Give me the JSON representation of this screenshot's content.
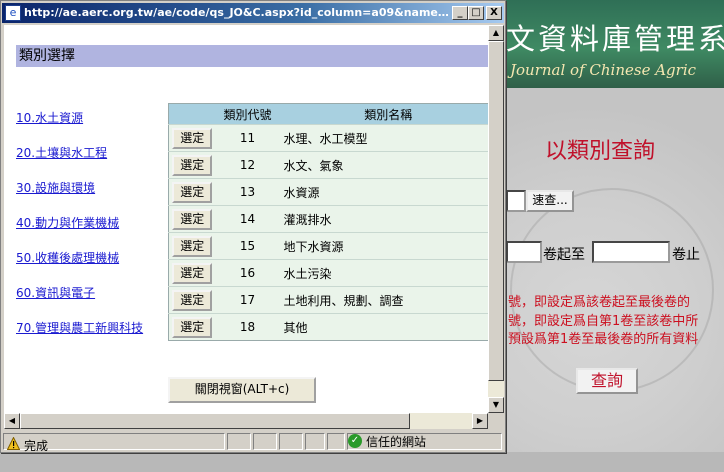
{
  "popup": {
    "title": "http://ae.aerc.org.tw/ae/code/qs_JO&C.aspx?id_column=a09&name_colum...",
    "section_title": "類別選擇",
    "categories": [
      {
        "label": "10.水土資源"
      },
      {
        "label": "20.土壤與水工程"
      },
      {
        "label": "30.設施與環境"
      },
      {
        "label": "40.動力與作業機械"
      },
      {
        "label": "50.收穫後處理機械"
      },
      {
        "label": "60.資訊與電子"
      },
      {
        "label": "70.管理與農工新興科技"
      }
    ],
    "table": {
      "headers": [
        "",
        "類別代號",
        "類別名稱"
      ],
      "select_label": "選定",
      "rows": [
        {
          "code": "11",
          "name": "水理、水工模型"
        },
        {
          "code": "12",
          "name": "水文、氣象"
        },
        {
          "code": "13",
          "name": "水資源"
        },
        {
          "code": "14",
          "name": "灌溉排水"
        },
        {
          "code": "15",
          "name": "地下水資源"
        },
        {
          "code": "16",
          "name": "水土污染"
        },
        {
          "code": "17",
          "name": "土地利用、規劃、調查"
        },
        {
          "code": "18",
          "name": "其他"
        }
      ]
    },
    "close_button": "關閉視窗(ALT+c)",
    "status": {
      "done": "完成",
      "zone": "信任的網站"
    },
    "window_buttons": {
      "minimize": "_",
      "maximize": "□",
      "close": "X"
    }
  },
  "background": {
    "title_cn": "文資料庫管理系",
    "title_en": "Journal of Chinese Agric",
    "heading": "以類別查詢",
    "quick_button": "速查...",
    "range_from": "卷起至",
    "range_to": "卷止",
    "notes": [
      "號，即設定爲該卷起至最後卷的",
      "號，即設定爲自第1卷至該卷中所",
      "預設爲第1卷至最後卷的所有資料"
    ],
    "query_button": "查詢"
  },
  "colors": {
    "titlebar": "#0a246a",
    "section_header": "#b0b4e0",
    "table_header": "#a8d0e0",
    "link": "#1a1ad0",
    "accent_red": "#c0102a"
  },
  "icons": [
    "ie-page-icon",
    "warning-icon",
    "trusted-site-icon",
    "scroll-arrow-icon"
  ]
}
